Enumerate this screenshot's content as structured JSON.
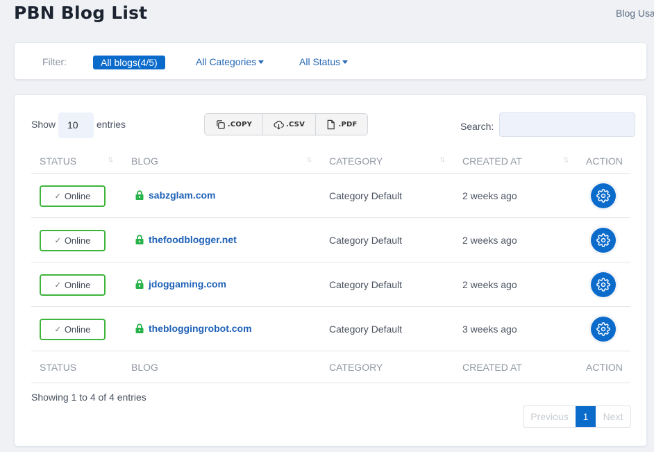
{
  "header": {
    "title": "PBN Blog List",
    "breadcrumb": "Blog Usa"
  },
  "filter": {
    "label": "Filter:",
    "active_pill": "All blogs(4/5)",
    "categories_dropdown": "All Categories",
    "status_dropdown": "All Status"
  },
  "toolbar": {
    "show_label": "Show",
    "page_length": "10",
    "entries_label": "entries",
    "buttons": [
      {
        "label": ".COPY",
        "icon": "copy-icon"
      },
      {
        "label": ".CSV",
        "icon": "cloud-download-icon"
      },
      {
        "label": ".PDF",
        "icon": "file-icon"
      }
    ],
    "search_label": "Search:",
    "search_value": ""
  },
  "table": {
    "columns": [
      "STATUS",
      "BLOG",
      "CATEGORY",
      "CREATED AT",
      "ACTION"
    ],
    "rows": [
      {
        "status": "Online",
        "blog": "sabzglam.com",
        "category": "Category Default",
        "created": "2 weeks ago"
      },
      {
        "status": "Online",
        "blog": "thefoodblogger.net",
        "category": "Category Default",
        "created": "2 weeks ago"
      },
      {
        "status": "Online",
        "blog": "jdoggaming.com",
        "category": "Category Default",
        "created": "2 weeks ago"
      },
      {
        "status": "Online",
        "blog": "thebloggingrobot.com",
        "category": "Category Default",
        "created": "3 weeks ago"
      }
    ]
  },
  "footer": {
    "info": "Showing 1 to 4 of 4 entries",
    "pagination": {
      "previous": "Previous",
      "current": "1",
      "next": "Next"
    }
  },
  "colors": {
    "primary": "#0b6bcb",
    "online_border": "#3db53a",
    "lock": "#27b24a",
    "link": "#1f62b8"
  }
}
